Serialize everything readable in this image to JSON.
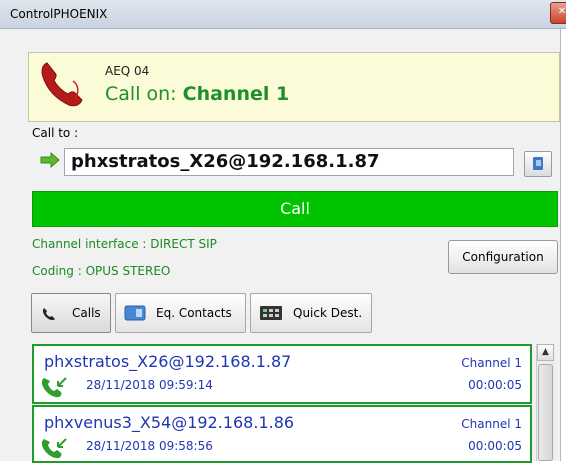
{
  "window": {
    "title": "ControlPHOENIX",
    "close_glyph": "✕"
  },
  "status": {
    "icon": "phone-icon",
    "device": "AEQ 04",
    "call_prefix": "Call on:",
    "channel": "Channel 1"
  },
  "call_to": {
    "label": "Call to :",
    "value": "phxstratos_X26@192.168.1.87",
    "book_icon": "address-book-icon"
  },
  "call_button": {
    "label": "Call",
    "color": "#00c400"
  },
  "info": {
    "interface": "Channel interface : DIRECT SIP",
    "coding": "Coding : OPUS STEREO"
  },
  "configuration_button": {
    "label": "Configuration"
  },
  "tabs": [
    {
      "label": "Calls",
      "icon": "phone-icon",
      "active": true
    },
    {
      "label": "Eq. Contacts",
      "icon": "contacts-icon",
      "active": false
    },
    {
      "label": "Quick Dest.",
      "icon": "quick-dest-icon",
      "active": false
    }
  ],
  "calls": [
    {
      "address": "phxstratos_X26@192.168.1.87",
      "datetime": "28/11/2018 09:59:14",
      "channel": "Channel 1",
      "duration": "00:00:05"
    },
    {
      "address": "phxvenus3_X54@192.168.1.86",
      "datetime": "28/11/2018 09:58:56",
      "channel": "Channel 1",
      "duration": "00:00:05"
    }
  ],
  "colors": {
    "accent_green": "#1c8a22",
    "call_green": "#00c400",
    "link_blue": "#1f36b3",
    "status_bg": "#fbfbd8"
  }
}
